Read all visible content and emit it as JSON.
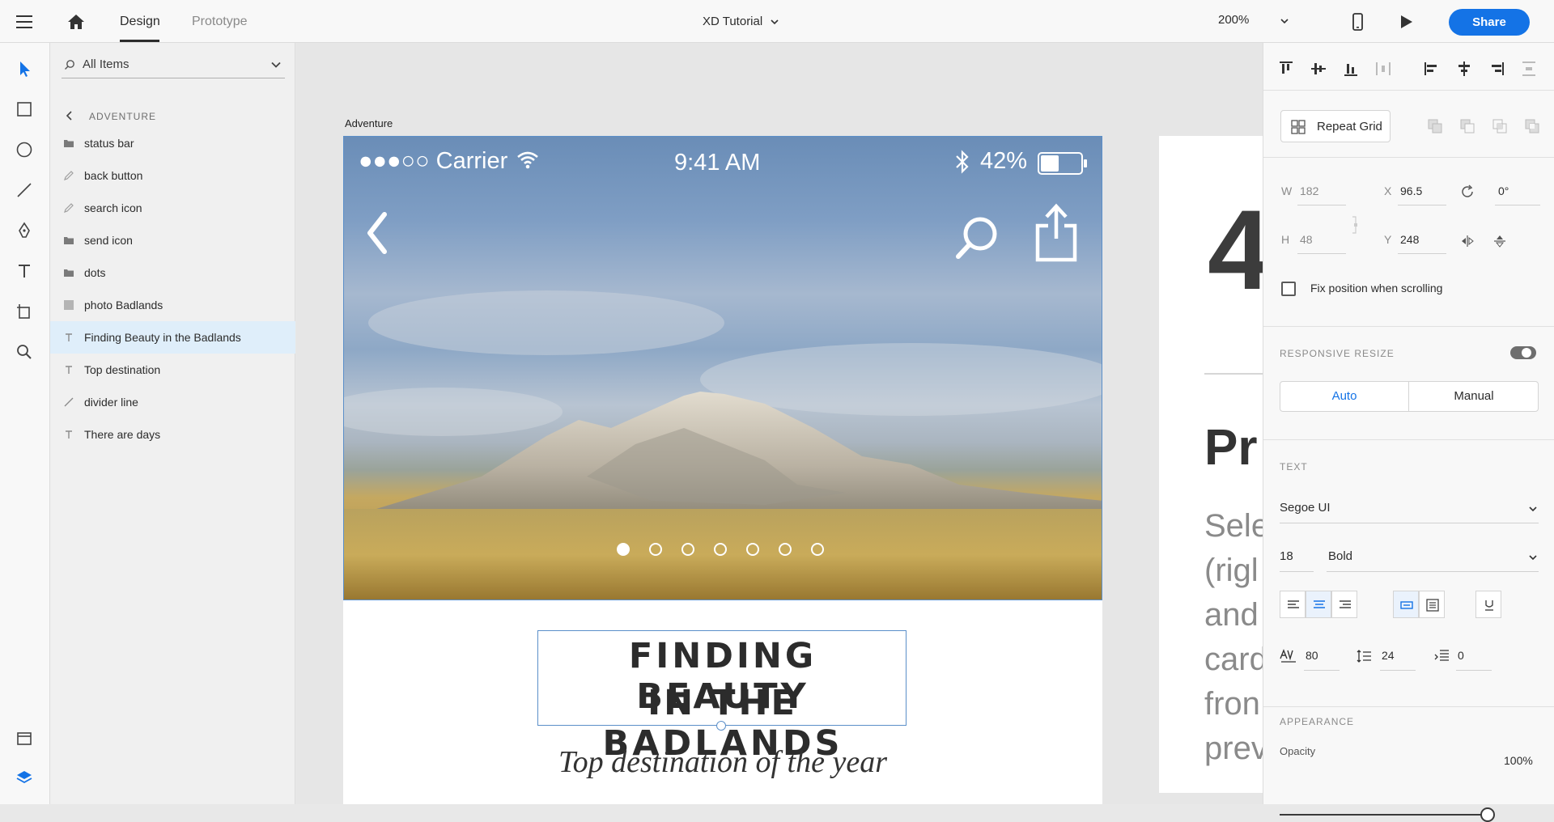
{
  "topbar": {
    "tab_design": "Design",
    "tab_prototype": "Prototype",
    "doc_title": "XD Tutorial",
    "zoom": "200%",
    "share_label": "Share"
  },
  "layers": {
    "search_label": "All Items",
    "breadcrumb": "ADVENTURE",
    "items": [
      {
        "label": "status bar",
        "icon": "folder-icon"
      },
      {
        "label": "back button",
        "icon": "pen-path-icon"
      },
      {
        "label": "search icon",
        "icon": "pen-path-icon"
      },
      {
        "label": "send icon",
        "icon": "folder-icon"
      },
      {
        "label": "dots",
        "icon": "folder-icon"
      },
      {
        "label": "photo Badlands",
        "icon": "image-icon"
      },
      {
        "label": "Finding Beauty in the Badlands",
        "icon": "text-icon",
        "selected": true
      },
      {
        "label": "Top destination",
        "icon": "text-icon"
      },
      {
        "label": "divider line",
        "icon": "line-icon"
      },
      {
        "label": "There are days",
        "icon": "text-icon"
      }
    ]
  },
  "canvas": {
    "artboard_label": "Adventure",
    "status_carrier": "●●●○○ Carrier",
    "status_time": "9:41 AM",
    "status_battery": "42%",
    "carousel_dots": 7,
    "carousel_active": 1,
    "title_line1": "FINDING BEAUTY",
    "title_line2": "IN THE BADLANDS",
    "subtitle": "Top destination of the year",
    "artboard2_big": "4",
    "artboard2_heading": "Pr",
    "artboard2_body": [
      "Sele",
      "(rigl",
      "and",
      "card",
      "fron",
      "prev"
    ]
  },
  "inspector": {
    "repeat_grid_label": "Repeat Grid",
    "w_label": "W",
    "w_value": "182",
    "h_label": "H",
    "h_value": "48",
    "x_label": "X",
    "x_value": "96.5",
    "y_label": "Y",
    "y_value": "248",
    "rotation": "0°",
    "fix_position_label": "Fix position when scrolling",
    "responsive_resize_label": "RESPONSIVE RESIZE",
    "seg_auto": "Auto",
    "seg_manual": "Manual",
    "text_section_label": "TEXT",
    "font_family": "Segoe UI",
    "font_size": "18",
    "font_weight": "Bold",
    "char_spacing": "80",
    "line_spacing": "24",
    "para_spacing": "0",
    "appearance_label": "APPEARANCE",
    "opacity_label": "Opacity",
    "opacity_value": "100%",
    "opacity_fraction": 1.0
  },
  "colors": {
    "accent": "#1473e6",
    "selection_outline": "#5b8fc9",
    "selected_layer_bg": "#dfeefa"
  }
}
